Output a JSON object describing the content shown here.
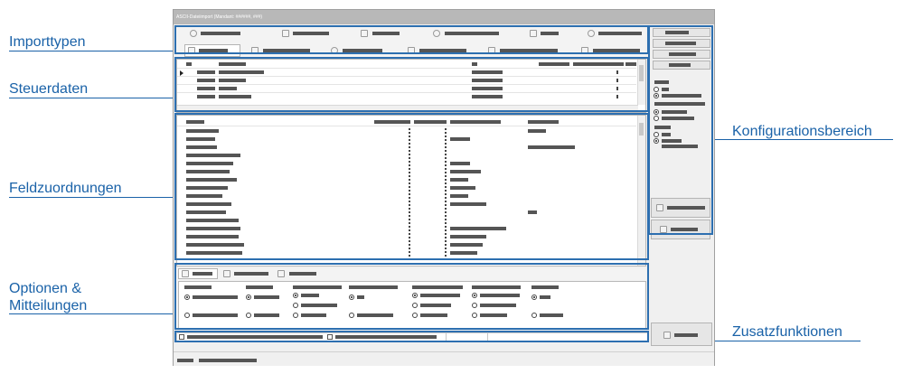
{
  "window": {
    "title": "ASCII-Dateiimport (Mandant: ######, ###)"
  },
  "callouts": {
    "importtypen": "Importtypen",
    "steuerdaten": "Steuerdaten",
    "feldzuordnungen": "Feldzuordnungen",
    "optionen_line1": "Optionen &",
    "optionen_line2": "Mitteilungen",
    "konfigurationsbereich": "Konfigurationsbereich",
    "zusatzfunktionen": "Zusatzfunktionen"
  },
  "colors": {
    "accent": "#1a62a8",
    "frame": "#2d6fb0",
    "titlebar": "#b8b8b8"
  },
  "icons": [
    "clock-icon",
    "users-icon",
    "document-icon",
    "gear-icon",
    "table-icon",
    "search-icon",
    "grid-icon",
    "folder-icon",
    "users-icon",
    "list-icon",
    "table-icon",
    "document-icon"
  ]
}
